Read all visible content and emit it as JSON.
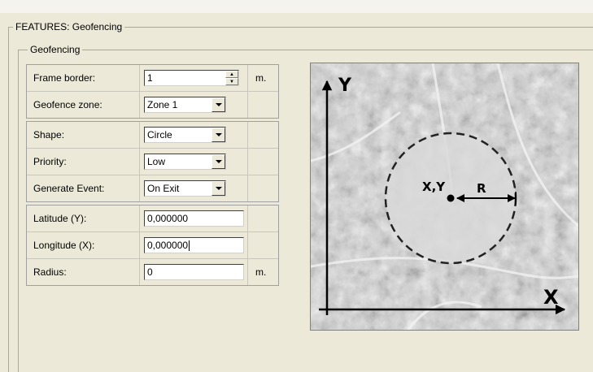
{
  "panel_title": "FEATURES: Geofencing",
  "group_title": "Geofencing",
  "sections": [
    {
      "rows": [
        {
          "id": "frame-border",
          "label": "Frame border:",
          "value": "1",
          "control": "spinner",
          "unit": "m."
        },
        {
          "id": "geofence-zone",
          "label": "Geofence zone:",
          "value": "Zone 1",
          "control": "dropdown",
          "unit": ""
        }
      ]
    },
    {
      "rows": [
        {
          "id": "shape",
          "label": "Shape:",
          "value": "Circle",
          "control": "dropdown",
          "unit": ""
        },
        {
          "id": "priority",
          "label": "Priority:",
          "value": "Low",
          "control": "dropdown",
          "unit": ""
        },
        {
          "id": "generate-event",
          "label": "Generate Event:",
          "value": "On Exit",
          "control": "dropdown",
          "unit": ""
        }
      ]
    },
    {
      "rows": [
        {
          "id": "latitude",
          "label": "Latitude (Y):",
          "value": "0,000000",
          "control": "text",
          "unit": ""
        },
        {
          "id": "longitude",
          "label": "Longitude (X):",
          "value": "0,000000",
          "control": "text-focused",
          "unit": ""
        },
        {
          "id": "radius",
          "label": "Radius:",
          "value": "0",
          "control": "text",
          "unit": "m."
        }
      ]
    }
  ],
  "diagram": {
    "axis_y": "Y",
    "axis_x": "X",
    "center_label": "X,Y",
    "radius_label": "R"
  }
}
